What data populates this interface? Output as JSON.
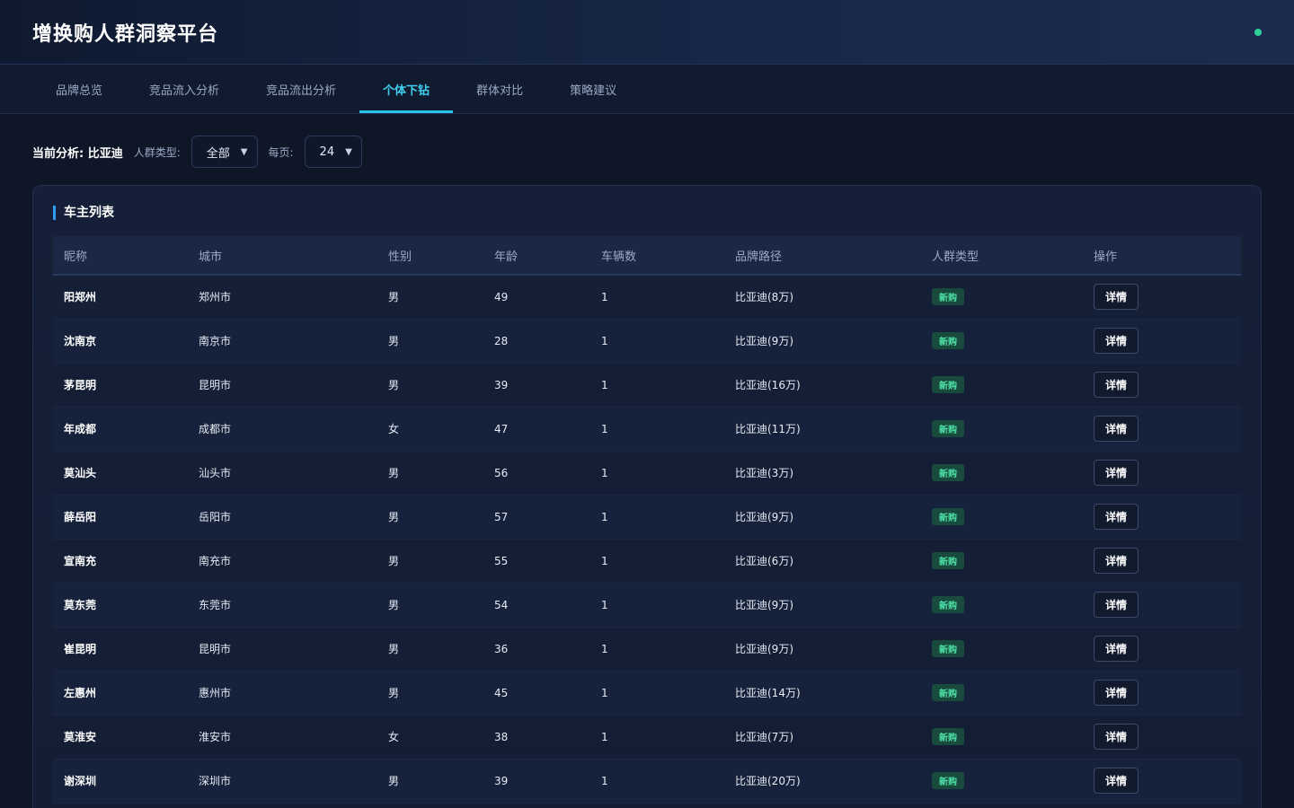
{
  "header": {
    "title": "增换购人群洞察平台"
  },
  "tabs": [
    {
      "label": "品牌总览",
      "active": false
    },
    {
      "label": "竞品流入分析",
      "active": false
    },
    {
      "label": "竞品流出分析",
      "active": false
    },
    {
      "label": "个体下钻",
      "active": true
    },
    {
      "label": "群体对比",
      "active": false
    },
    {
      "label": "策略建议",
      "active": false
    }
  ],
  "filters": {
    "current_label": "当前分析: 比亚迪",
    "crowd_type_label": "人群类型:",
    "crowd_type_value": "全部",
    "page_size_label": "每页:",
    "page_size_value": "24"
  },
  "card": {
    "title": "车主列表"
  },
  "table": {
    "columns": [
      "昵称",
      "城市",
      "性别",
      "年龄",
      "车辆数",
      "品牌路径",
      "人群类型",
      "操作"
    ],
    "action_label": "详情",
    "rows": [
      {
        "nick": "阳郑州",
        "city": "郑州市",
        "gender": "男",
        "age": "49",
        "cars": "1",
        "path": "比亚迪(8万)",
        "type": "新购"
      },
      {
        "nick": "沈南京",
        "city": "南京市",
        "gender": "男",
        "age": "28",
        "cars": "1",
        "path": "比亚迪(9万)",
        "type": "新购"
      },
      {
        "nick": "茅昆明",
        "city": "昆明市",
        "gender": "男",
        "age": "39",
        "cars": "1",
        "path": "比亚迪(16万)",
        "type": "新购"
      },
      {
        "nick": "年成都",
        "city": "成都市",
        "gender": "女",
        "age": "47",
        "cars": "1",
        "path": "比亚迪(11万)",
        "type": "新购"
      },
      {
        "nick": "莫汕头",
        "city": "汕头市",
        "gender": "男",
        "age": "56",
        "cars": "1",
        "path": "比亚迪(3万)",
        "type": "新购"
      },
      {
        "nick": "薛岳阳",
        "city": "岳阳市",
        "gender": "男",
        "age": "57",
        "cars": "1",
        "path": "比亚迪(9万)",
        "type": "新购"
      },
      {
        "nick": "宣南充",
        "city": "南充市",
        "gender": "男",
        "age": "55",
        "cars": "1",
        "path": "比亚迪(6万)",
        "type": "新购"
      },
      {
        "nick": "莫东莞",
        "city": "东莞市",
        "gender": "男",
        "age": "54",
        "cars": "1",
        "path": "比亚迪(9万)",
        "type": "新购"
      },
      {
        "nick": "崔昆明",
        "city": "昆明市",
        "gender": "男",
        "age": "36",
        "cars": "1",
        "path": "比亚迪(9万)",
        "type": "新购"
      },
      {
        "nick": "左惠州",
        "city": "惠州市",
        "gender": "男",
        "age": "45",
        "cars": "1",
        "path": "比亚迪(14万)",
        "type": "新购"
      },
      {
        "nick": "莫淮安",
        "city": "淮安市",
        "gender": "女",
        "age": "38",
        "cars": "1",
        "path": "比亚迪(7万)",
        "type": "新购"
      },
      {
        "nick": "谢深圳",
        "city": "深圳市",
        "gender": "男",
        "age": "39",
        "cars": "1",
        "path": "比亚迪(20万)",
        "type": "新购"
      }
    ]
  },
  "colors": {
    "accent": "#27c3e8",
    "status_dot": "#2ed39a",
    "badge_text": "#4de3a8"
  }
}
